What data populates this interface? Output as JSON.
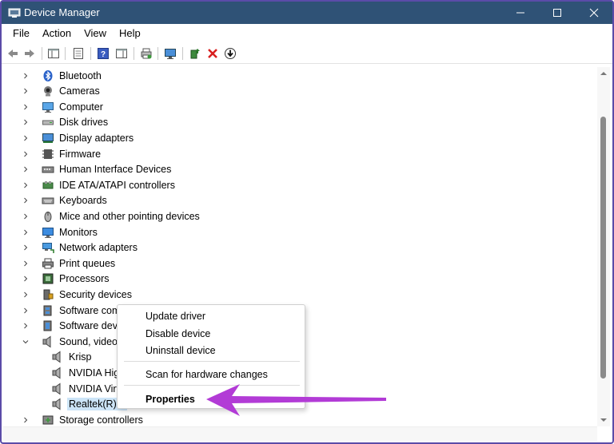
{
  "window": {
    "title": "Device Manager",
    "app_icon": "device-manager-icon"
  },
  "window_controls": [
    "minimize-icon",
    "maximize-icon",
    "close-icon"
  ],
  "menu": [
    "File",
    "Action",
    "View",
    "Help"
  ],
  "toolbar": [
    "back-icon",
    "forward-icon",
    "show-hide-console-tree-icon",
    "properties-icon",
    "help-icon",
    "action-pane-icon",
    "scan-hardware-icon",
    "display-monitor-icon",
    "update-driver-icon",
    "uninstall-icon",
    "download-icon"
  ],
  "tree": {
    "items": [
      {
        "label": "Bluetooth",
        "icon": "bluetooth-icon",
        "expanded": false
      },
      {
        "label": "Cameras",
        "icon": "camera-icon",
        "expanded": false
      },
      {
        "label": "Computer",
        "icon": "computer-icon",
        "expanded": false
      },
      {
        "label": "Disk drives",
        "icon": "disk-drive-icon",
        "expanded": false
      },
      {
        "label": "Display adapters",
        "icon": "display-adapter-icon",
        "expanded": false
      },
      {
        "label": "Firmware",
        "icon": "firmware-icon",
        "expanded": false
      },
      {
        "label": "Human Interface Devices",
        "icon": "hid-icon",
        "expanded": false
      },
      {
        "label": "IDE ATA/ATAPI controllers",
        "icon": "ide-controller-icon",
        "expanded": false
      },
      {
        "label": "Keyboards",
        "icon": "keyboard-icon",
        "expanded": false
      },
      {
        "label": "Mice and other pointing devices",
        "icon": "mouse-icon",
        "expanded": false
      },
      {
        "label": "Monitors",
        "icon": "monitor-icon",
        "expanded": false
      },
      {
        "label": "Network adapters",
        "icon": "network-adapter-icon",
        "expanded": false
      },
      {
        "label": "Print queues",
        "icon": "printer-icon",
        "expanded": false
      },
      {
        "label": "Processors",
        "icon": "processor-icon",
        "expanded": false
      },
      {
        "label": "Security devices",
        "icon": "security-device-icon",
        "expanded": false
      },
      {
        "label": "Software comp",
        "icon": "software-component-icon",
        "expanded": false
      },
      {
        "label": "Software device",
        "icon": "software-device-icon",
        "expanded": false
      },
      {
        "label": "Sound, video ar",
        "icon": "speaker-icon",
        "expanded": true
      },
      {
        "label": "Krisp",
        "icon": "speaker-icon",
        "child": true
      },
      {
        "label": "NVIDIA Hig",
        "icon": "speaker-icon",
        "child": true
      },
      {
        "label": "NVIDIA Virt",
        "icon": "speaker-icon",
        "child": true
      },
      {
        "label": "Realtek(R) A",
        "icon": "speaker-icon",
        "child": true,
        "selected": true
      },
      {
        "label": "Storage controllers",
        "icon": "storage-controller-icon",
        "expanded": false
      }
    ]
  },
  "context_menu": {
    "items": [
      "Update driver",
      "Disable device",
      "Uninstall device",
      "Scan for hardware changes",
      "Properties"
    ]
  },
  "colors": {
    "titlebar": "#2f5276",
    "frame": "#5b4ba8",
    "selection": "#cce4f7",
    "arrow": "#b23bd6"
  }
}
